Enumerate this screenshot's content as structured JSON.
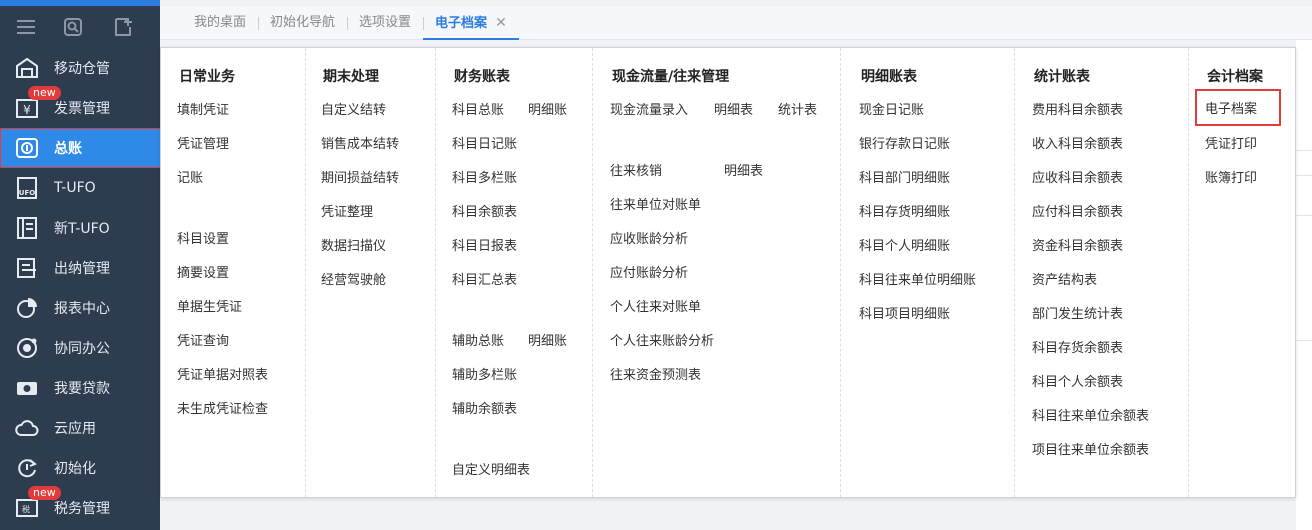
{
  "sidebar": {
    "items": [
      {
        "label": "移动仓管",
        "icon": "warehouse-icon",
        "badge": ""
      },
      {
        "label": "发票管理",
        "icon": "invoice-icon",
        "badge": "new"
      },
      {
        "label": "总账",
        "icon": "ledger-icon",
        "badge": ""
      },
      {
        "label": "T-UFO",
        "icon": "ufo-report-icon",
        "badge": ""
      },
      {
        "label": "新T-UFO",
        "icon": "new-ufo-report-icon",
        "badge": ""
      },
      {
        "label": "出纳管理",
        "icon": "cashier-icon",
        "badge": ""
      },
      {
        "label": "报表中心",
        "icon": "pie-chart-icon",
        "badge": ""
      },
      {
        "label": "协同办公",
        "icon": "collaboration-icon",
        "badge": ""
      },
      {
        "label": "我要贷款",
        "icon": "loan-icon",
        "badge": ""
      },
      {
        "label": "云应用",
        "icon": "cloud-icon",
        "badge": ""
      },
      {
        "label": "初始化",
        "icon": "refresh-icon",
        "badge": ""
      },
      {
        "label": "税务管理",
        "icon": "tax-icon",
        "badge": "new"
      }
    ]
  },
  "tabs": [
    {
      "label": "我的桌面"
    },
    {
      "label": "初始化导航"
    },
    {
      "label": "选项设置"
    },
    {
      "label": "电子档案",
      "close": "✕"
    }
  ],
  "menu": {
    "daily": {
      "title": "日常业务",
      "items": [
        "填制凭证",
        "凭证管理",
        "记账",
        "科目设置",
        "摘要设置",
        "单据生凭证",
        "凭证查询",
        "凭证单据对照表",
        "未生成凭证检查"
      ]
    },
    "period_end": {
      "title": "期末处理",
      "items": [
        "自定义结转",
        "销售成本结转",
        "期间损益结转",
        "凭证整理",
        "数据扫描仪",
        "经营驾驶舱"
      ]
    },
    "finance": {
      "title": "财务账表",
      "items": [
        "科目总账",
        "明细账",
        "科目日记账",
        "科目多栏账",
        "科目余额表",
        "科目日报表",
        "科目汇总表",
        "辅助总账",
        "明细账",
        "辅助多栏账",
        "辅助余额表",
        "自定义明细表"
      ]
    },
    "cashflow": {
      "title": "现金流量/往来管理",
      "items": [
        "现金流量录入",
        "明细表",
        "统计表",
        "往来核销",
        "明细表",
        "往来单位对账单",
        "应收账龄分析",
        "应付账龄分析",
        "个人往来对账单",
        "个人往来账龄分析",
        "往来资金预测表"
      ]
    },
    "detail": {
      "title": "明细账表",
      "items": [
        "现金日记账",
        "银行存款日记账",
        "科目部门明细账",
        "科目存货明细账",
        "科目个人明细账",
        "科目往来单位明细账",
        "科目项目明细账"
      ]
    },
    "stats": {
      "title": "统计账表",
      "items": [
        "费用科目余额表",
        "收入科目余额表",
        "应收科目余额表",
        "应付科目余额表",
        "资金科目余额表",
        "资产结构表",
        "部门发生统计表",
        "科目存货余额表",
        "科目个人余额表",
        "科目往来单位余额表",
        "项目往来单位余额表"
      ]
    },
    "archive": {
      "title": "会计档案",
      "items": [
        "电子档案",
        "凭证打印",
        "账簿打印"
      ]
    }
  },
  "colors": {
    "sidebar_bg": "#2d3c4e",
    "active_blue": "#2e8ae6",
    "highlight_red": "#e23b3b",
    "tab_active": "#2b7de1"
  }
}
